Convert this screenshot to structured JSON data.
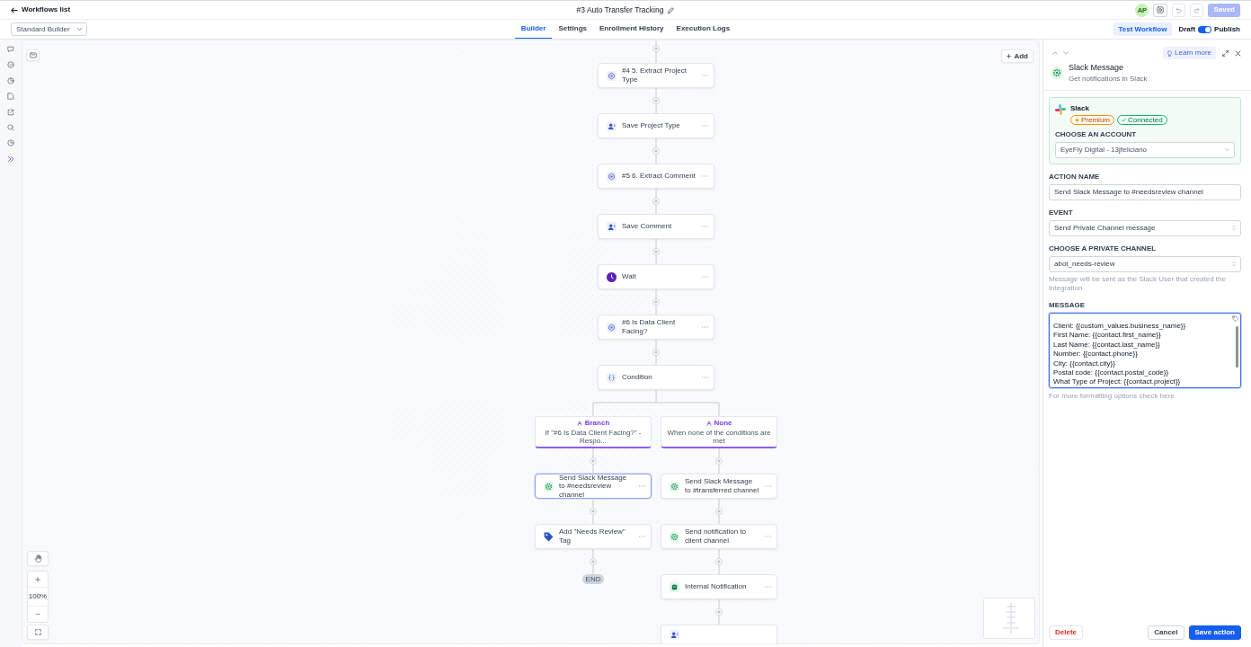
{
  "header": {
    "back_link": "Workflows list",
    "title": "#3 Auto Transfer Tracking",
    "avatar": "AP",
    "save_button": {
      "label": "Saved",
      "disabled": true
    }
  },
  "toolbar": {
    "builder_select": "Standard Builder",
    "tabs": [
      {
        "label": "Builder",
        "selected": true
      },
      {
        "label": "Settings",
        "selected": false
      },
      {
        "label": "Enrollment History",
        "selected": false
      },
      {
        "label": "Execution Logs",
        "selected": false
      }
    ],
    "test_button": "Test Workflow",
    "draft_label": "Draft",
    "publish_toggle": {
      "on": true
    },
    "publish_label": "Publish"
  },
  "sidebar": {
    "items": [
      {
        "selected": false
      },
      {
        "selected": false
      },
      {
        "selected": false
      },
      {
        "selected": false
      },
      {
        "selected": false
      },
      {
        "selected": false
      },
      {
        "selected": false
      },
      {
        "selected": true
      }
    ]
  },
  "canvas": {
    "add_button": "Add",
    "zoom": "100%",
    "steps": [
      {
        "kind": "ai",
        "label": "#4 5. Extract Project Type",
        "selected": false
      },
      {
        "kind": "contact",
        "label": "Save Project Type",
        "selected": false
      },
      {
        "kind": "ai",
        "label": "#5 6. Extract Comment",
        "selected": false
      },
      {
        "kind": "contact",
        "label": "Save Comment",
        "selected": false
      },
      {
        "kind": "wait",
        "label": "Wait",
        "selected": false
      },
      {
        "kind": "ai",
        "label": "#6 Is Data Client Facing?",
        "selected": false
      },
      {
        "kind": "condition",
        "label": "Condition",
        "selected": false
      }
    ],
    "branches": [
      {
        "label": "Branch",
        "description": "If \"#6 Is Data Client Facing?\" - Respo...",
        "steps": [
          {
            "kind": "slack",
            "label": "Send Slack Message to #needsreview channel",
            "selected": true
          },
          {
            "kind": "tag",
            "label": "Add \"Needs Review\" Tag",
            "selected": false
          }
        ],
        "end": "END"
      },
      {
        "label": "None",
        "description": "When none of the conditions are met",
        "steps": [
          {
            "kind": "slack",
            "label": "Send Slack Message to #transferred channel",
            "selected": false
          },
          {
            "kind": "slack",
            "label": "Send notification to client channel",
            "selected": false
          },
          {
            "kind": "notification",
            "label": "Internal Notification",
            "selected": false
          },
          {
            "kind": "contact",
            "selected": false
          }
        ]
      }
    ]
  },
  "panel": {
    "title": "Slack Message",
    "subtitle": "Get notifications in Slack",
    "learn_more": "Learn more",
    "app": {
      "name": "Slack",
      "badges": [
        {
          "kind": "premium",
          "label": "Premium"
        },
        {
          "kind": "connected",
          "label": "Connected"
        }
      ],
      "account_label": "CHOOSE AN ACCOUNT",
      "account": "EyeFly Digital - 13jfeliciano"
    },
    "fields": [
      {
        "kind": "input",
        "label": "ACTION NAME",
        "value": "Send Slack Message to #needsreview channel"
      },
      {
        "kind": "select",
        "label": "EVENT",
        "value": "Send Private Channel message"
      },
      {
        "kind": "select",
        "label": "CHOOSE A PRIVATE CHANNEL",
        "value": "abot_needs-review",
        "hint": "Message will be sent as the Slack User that created the integration"
      },
      {
        "kind": "textarea",
        "label": "MESSAGE",
        "focused": true,
        "lines": [
          "Client: {{custom_values.business_name}}",
          "First Name: {{contact.first_name}}",
          "Last Name: {{contact.last_name}}",
          "Number: {{contact.phone}}",
          "City: {{contact.city}}",
          "Postal code: {{contact.postal_code}}",
          "What Type of Project: {{contact.project}}"
        ]
      }
    ],
    "help": {
      "text": "For more formatting options",
      "link": "check here"
    },
    "buttons": {
      "delete": "Delete",
      "cancel": "Cancel",
      "save": "Save action"
    }
  }
}
